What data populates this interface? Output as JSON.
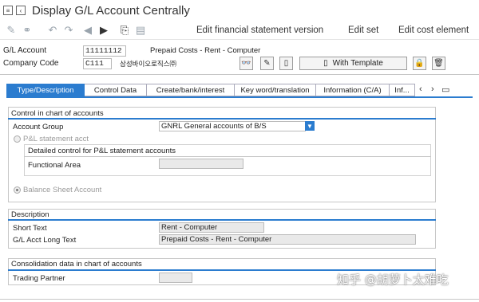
{
  "window": {
    "title": "Display G/L Account Centrally"
  },
  "toolbar": {
    "edit_fs_version": "Edit financial statement version",
    "edit_set": "Edit set",
    "edit_cost_element": "Edit cost element"
  },
  "header": {
    "gl_account_label": "G/L Account",
    "gl_account_value": "11111112",
    "gl_account_desc": "Prepaid Costs - Rent - Computer",
    "company_code_label": "Company Code",
    "company_code_value": "C111",
    "company_name": "삼성바이오로직스㈜",
    "with_template_label": "With Template"
  },
  "tabs": [
    {
      "label": "Type/Description",
      "active": true
    },
    {
      "label": "Control Data"
    },
    {
      "label": "Create/bank/interest"
    },
    {
      "label": "Key word/translation"
    },
    {
      "label": "Information (C/A)"
    },
    {
      "label": "Inf..."
    }
  ],
  "control_group": {
    "title": "Control in chart of accounts",
    "account_group_label": "Account Group",
    "account_group_value": "GNRL General accounts of B/S",
    "pl_statement_label": "P&L statement acct",
    "detailed_control_label": "Detailed control for P&L statement accounts",
    "functional_area_label": "Functional Area",
    "functional_area_value": "",
    "balance_sheet_label": "Balance Sheet Account"
  },
  "description_group": {
    "title": "Description",
    "short_text_label": "Short Text",
    "short_text_value": "Rent - Computer",
    "long_text_label": "G/L Acct Long Text",
    "long_text_value": "Prepaid Costs - Rent - Computer"
  },
  "consolidation_group": {
    "title": "Consolidation data in chart of accounts",
    "trading_partner_label": "Trading Partner",
    "trading_partner_value": ""
  },
  "watermark": "知乎 @胡萝卜太难吃",
  "colors": {
    "accent": "#2b7ccf"
  }
}
